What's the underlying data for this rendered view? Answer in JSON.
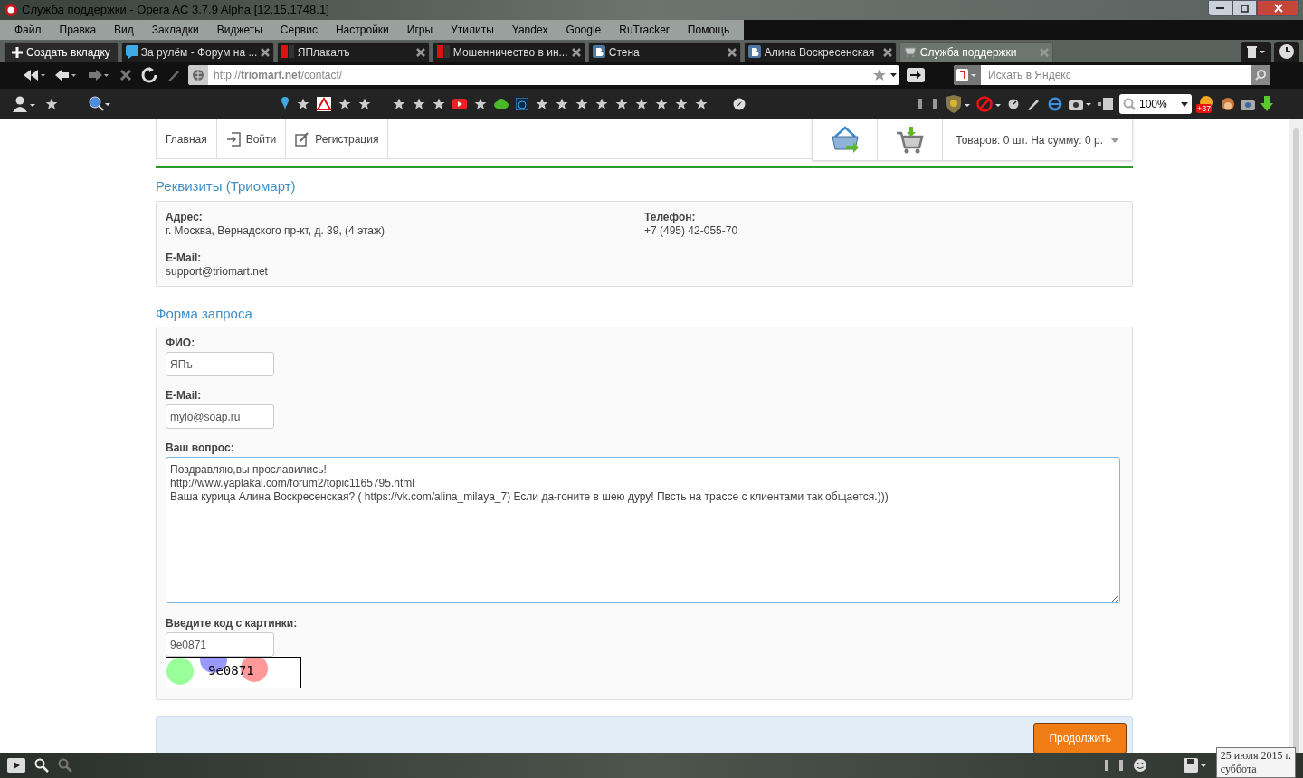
{
  "window": {
    "title": "Служба поддержки - Opera AC 3.7.9 Alpha [12.15.1748.1]"
  },
  "menu": [
    "Файл",
    "Правка",
    "Вид",
    "Закладки",
    "Виджеты",
    "Сервис",
    "Настройки",
    "Игры",
    "Утилиты",
    "Yandex",
    "Google",
    "RuTracker",
    "Помощь"
  ],
  "new_tab": "Создать вкладку",
  "tabs": [
    {
      "label": "За рулём - Форум на ...",
      "selected": false
    },
    {
      "label": "ЯПлакалъ",
      "selected": false
    },
    {
      "label": "Мошенничество в ин...",
      "selected": false
    },
    {
      "label": "Стена",
      "selected": false
    },
    {
      "label": "Алина Воскресенская",
      "selected": false
    },
    {
      "label": "Служба поддержки",
      "selected": true
    }
  ],
  "address": "http://**triomart.net**/contact/",
  "search": {
    "placeholder": "Искать в Яндекс"
  },
  "zoom": "100%",
  "notification_badge": "+37",
  "site_nav": [
    "Главная",
    "Войти",
    "Регистрация"
  ],
  "cart_summary": "Товаров: 0 шт. На сумму: 0 р.",
  "details": {
    "title": "Реквизиты (Триомарт)",
    "fields": [
      {
        "label": "Адрес:",
        "value": "г. Москва, Вернадского пр-кт, д. 39, (4 этаж)"
      },
      {
        "label": "Телефон:",
        "value": "+7 (495) 42-055-70"
      },
      {
        "label": "E-Mail:",
        "value": "support@triomart.net"
      }
    ]
  },
  "form": {
    "title": "Форма запроса",
    "name": {
      "label": "ФИО:",
      "value": "ЯПъ"
    },
    "email": {
      "label": "E-Mail:",
      "value": "mylo@soap.ru"
    },
    "question": {
      "label": "Ваш вопрос:",
      "value": "Поздравляю,вы прославились!\nhttp://www.yaplakal.com/forum2/topic1165795.html\nВаша курица Алина Воскресенская? ( https://vk.com/alina_milaya_7) Если да-гоните в шею дуру! Пвсть на трассе с клиентами так общается.)))"
    },
    "captcha": {
      "label": "Введите код с картинки:",
      "value": "9e0871",
      "image_text": "9e0871"
    },
    "submit": "Продолжить"
  },
  "clock": {
    "date": "25 июля 2015 г.",
    "weekday": "суббота"
  }
}
